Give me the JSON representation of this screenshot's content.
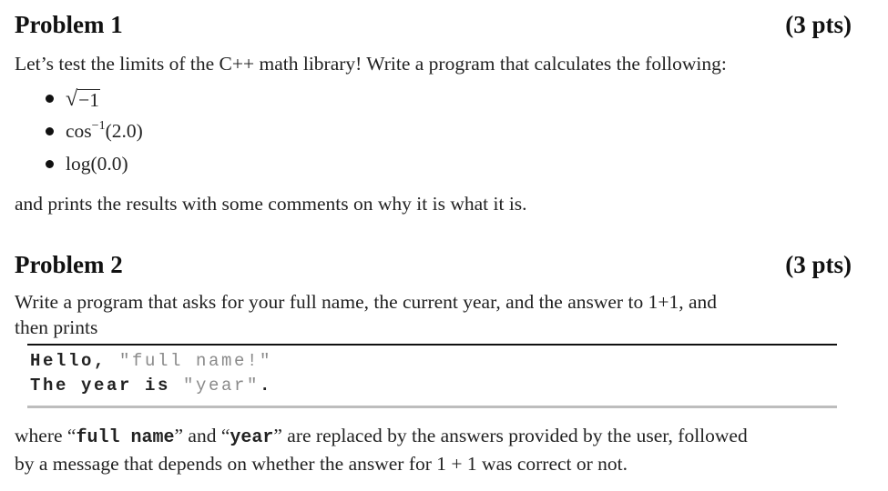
{
  "problem1": {
    "title": "Problem 1",
    "points": "(3 pts)",
    "intro": "Let’s test the limits of the C++ math library! Write a program that calculates the following:",
    "items": [
      {
        "label": "sqrt(-1)",
        "radicand": "−1"
      },
      {
        "label": "cos^-1(2.0)",
        "func": "cos",
        "sup": "−1",
        "arg": "(2.0)"
      },
      {
        "label": "log(0.0)",
        "text": "log(0.0)"
      }
    ],
    "outro": "and prints the results with some comments on why it is what it is."
  },
  "problem2": {
    "title": "Problem 2",
    "points": "(3 pts)",
    "intro_line1": "Write a program that asks for your full name, the current year, and the answer to 1+1, and",
    "intro_line2": "then prints",
    "code": {
      "line1_prefix": "Hello, ",
      "line1_placeholder": "\"full name!\"",
      "line2_prefix": "The year is ",
      "line2_placeholder": "\"year\"",
      "line2_suffix": "."
    },
    "outro": {
      "w1": "where “",
      "tt1": "full name",
      "w2": "” and “",
      "tt2": "year",
      "w3": "” are replaced by the answers provided by the user, followed",
      "line2": "by a message that depends on whether the answer for 1 + 1 was correct or not."
    }
  }
}
